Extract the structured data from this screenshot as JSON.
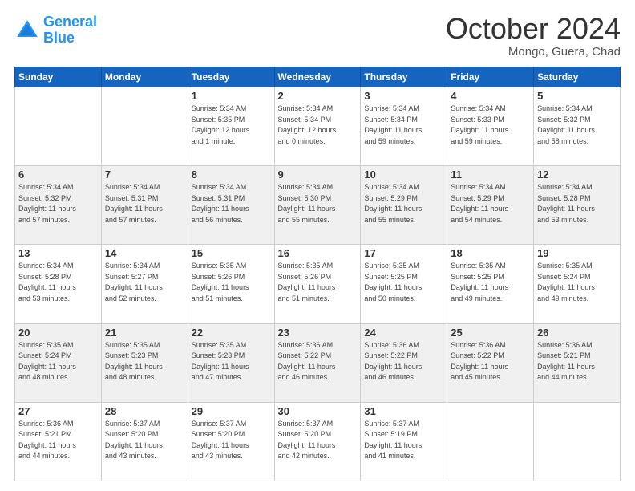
{
  "header": {
    "logo_line1": "General",
    "logo_line2": "Blue",
    "month": "October 2024",
    "location": "Mongo, Guera, Chad"
  },
  "weekdays": [
    "Sunday",
    "Monday",
    "Tuesday",
    "Wednesday",
    "Thursday",
    "Friday",
    "Saturday"
  ],
  "rows": [
    {
      "shaded": false,
      "cells": [
        {
          "day": "",
          "info": ""
        },
        {
          "day": "",
          "info": ""
        },
        {
          "day": "1",
          "info": "Sunrise: 5:34 AM\nSunset: 5:35 PM\nDaylight: 12 hours\nand 1 minute."
        },
        {
          "day": "2",
          "info": "Sunrise: 5:34 AM\nSunset: 5:34 PM\nDaylight: 12 hours\nand 0 minutes."
        },
        {
          "day": "3",
          "info": "Sunrise: 5:34 AM\nSunset: 5:34 PM\nDaylight: 11 hours\nand 59 minutes."
        },
        {
          "day": "4",
          "info": "Sunrise: 5:34 AM\nSunset: 5:33 PM\nDaylight: 11 hours\nand 59 minutes."
        },
        {
          "day": "5",
          "info": "Sunrise: 5:34 AM\nSunset: 5:32 PM\nDaylight: 11 hours\nand 58 minutes."
        }
      ]
    },
    {
      "shaded": true,
      "cells": [
        {
          "day": "6",
          "info": "Sunrise: 5:34 AM\nSunset: 5:32 PM\nDaylight: 11 hours\nand 57 minutes."
        },
        {
          "day": "7",
          "info": "Sunrise: 5:34 AM\nSunset: 5:31 PM\nDaylight: 11 hours\nand 57 minutes."
        },
        {
          "day": "8",
          "info": "Sunrise: 5:34 AM\nSunset: 5:31 PM\nDaylight: 11 hours\nand 56 minutes."
        },
        {
          "day": "9",
          "info": "Sunrise: 5:34 AM\nSunset: 5:30 PM\nDaylight: 11 hours\nand 55 minutes."
        },
        {
          "day": "10",
          "info": "Sunrise: 5:34 AM\nSunset: 5:29 PM\nDaylight: 11 hours\nand 55 minutes."
        },
        {
          "day": "11",
          "info": "Sunrise: 5:34 AM\nSunset: 5:29 PM\nDaylight: 11 hours\nand 54 minutes."
        },
        {
          "day": "12",
          "info": "Sunrise: 5:34 AM\nSunset: 5:28 PM\nDaylight: 11 hours\nand 53 minutes."
        }
      ]
    },
    {
      "shaded": false,
      "cells": [
        {
          "day": "13",
          "info": "Sunrise: 5:34 AM\nSunset: 5:28 PM\nDaylight: 11 hours\nand 53 minutes."
        },
        {
          "day": "14",
          "info": "Sunrise: 5:34 AM\nSunset: 5:27 PM\nDaylight: 11 hours\nand 52 minutes."
        },
        {
          "day": "15",
          "info": "Sunrise: 5:35 AM\nSunset: 5:26 PM\nDaylight: 11 hours\nand 51 minutes."
        },
        {
          "day": "16",
          "info": "Sunrise: 5:35 AM\nSunset: 5:26 PM\nDaylight: 11 hours\nand 51 minutes."
        },
        {
          "day": "17",
          "info": "Sunrise: 5:35 AM\nSunset: 5:25 PM\nDaylight: 11 hours\nand 50 minutes."
        },
        {
          "day": "18",
          "info": "Sunrise: 5:35 AM\nSunset: 5:25 PM\nDaylight: 11 hours\nand 49 minutes."
        },
        {
          "day": "19",
          "info": "Sunrise: 5:35 AM\nSunset: 5:24 PM\nDaylight: 11 hours\nand 49 minutes."
        }
      ]
    },
    {
      "shaded": true,
      "cells": [
        {
          "day": "20",
          "info": "Sunrise: 5:35 AM\nSunset: 5:24 PM\nDaylight: 11 hours\nand 48 minutes."
        },
        {
          "day": "21",
          "info": "Sunrise: 5:35 AM\nSunset: 5:23 PM\nDaylight: 11 hours\nand 48 minutes."
        },
        {
          "day": "22",
          "info": "Sunrise: 5:35 AM\nSunset: 5:23 PM\nDaylight: 11 hours\nand 47 minutes."
        },
        {
          "day": "23",
          "info": "Sunrise: 5:36 AM\nSunset: 5:22 PM\nDaylight: 11 hours\nand 46 minutes."
        },
        {
          "day": "24",
          "info": "Sunrise: 5:36 AM\nSunset: 5:22 PM\nDaylight: 11 hours\nand 46 minutes."
        },
        {
          "day": "25",
          "info": "Sunrise: 5:36 AM\nSunset: 5:22 PM\nDaylight: 11 hours\nand 45 minutes."
        },
        {
          "day": "26",
          "info": "Sunrise: 5:36 AM\nSunset: 5:21 PM\nDaylight: 11 hours\nand 44 minutes."
        }
      ]
    },
    {
      "shaded": false,
      "cells": [
        {
          "day": "27",
          "info": "Sunrise: 5:36 AM\nSunset: 5:21 PM\nDaylight: 11 hours\nand 44 minutes."
        },
        {
          "day": "28",
          "info": "Sunrise: 5:37 AM\nSunset: 5:20 PM\nDaylight: 11 hours\nand 43 minutes."
        },
        {
          "day": "29",
          "info": "Sunrise: 5:37 AM\nSunset: 5:20 PM\nDaylight: 11 hours\nand 43 minutes."
        },
        {
          "day": "30",
          "info": "Sunrise: 5:37 AM\nSunset: 5:20 PM\nDaylight: 11 hours\nand 42 minutes."
        },
        {
          "day": "31",
          "info": "Sunrise: 5:37 AM\nSunset: 5:19 PM\nDaylight: 11 hours\nand 41 minutes."
        },
        {
          "day": "",
          "info": ""
        },
        {
          "day": "",
          "info": ""
        }
      ]
    }
  ]
}
